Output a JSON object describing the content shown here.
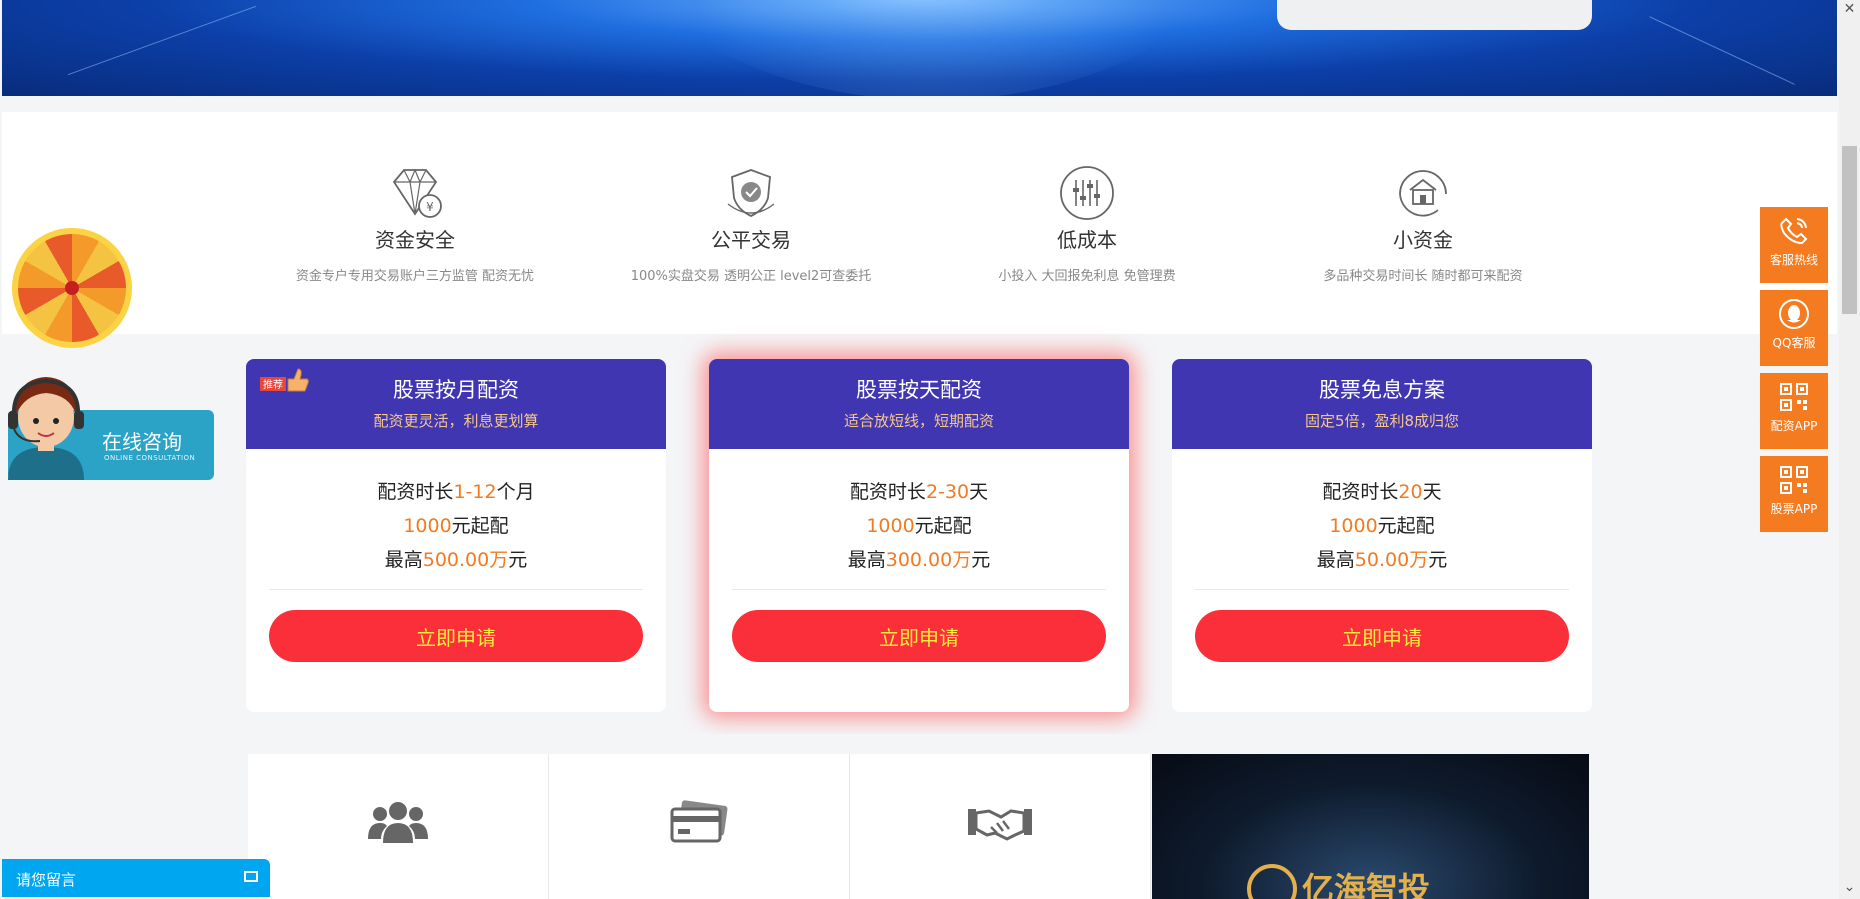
{
  "features": [
    {
      "title": "资金安全",
      "desc": "资金专户专用交易账户三方监管 配资无忧",
      "icon": "diamond-yen-icon"
    },
    {
      "title": "公平交易",
      "desc": "100%实盘交易 透明公正 level2可查委托",
      "icon": "shield-check-icon"
    },
    {
      "title": "低成本",
      "desc": "小投入 大回报免利息 免管理费",
      "icon": "sliders-icon"
    },
    {
      "title": "小资金",
      "desc": "多品种交易时间长 随时都可来配资",
      "icon": "house-icon"
    }
  ],
  "cards": [
    {
      "title": "股票按月配资",
      "subtitle": "配资更灵活，利息更划算",
      "badge": "推荐",
      "duration_pre": "配资时长",
      "duration_val": "1-12",
      "duration_unit": "个月",
      "min_val": "1000",
      "min_unit": "元起配",
      "max_pre": "最高",
      "max_val": "500.00",
      "max_wan": "万",
      "max_unit": "元",
      "button": "立即申请"
    },
    {
      "title": "股票按天配资",
      "subtitle": "适合放短线，短期配资",
      "duration_pre": "配资时长",
      "duration_val": "2-30",
      "duration_unit": "天",
      "min_val": "1000",
      "min_unit": "元起配",
      "max_pre": "最高",
      "max_val": "300.00",
      "max_wan": "万",
      "max_unit": "元",
      "button": "立即申请"
    },
    {
      "title": "股票免息方案",
      "subtitle": "固定5倍，盈利8成归您",
      "duration_pre": "配资时长",
      "duration_val": "20",
      "duration_unit": "天",
      "min_val": "1000",
      "min_unit": "元起配",
      "max_pre": "最高",
      "max_val": "50.00",
      "max_wan": "万",
      "max_unit": "元",
      "button": "立即申请"
    }
  ],
  "consult": {
    "main": "在线咨询",
    "sub": "ONLINE CONSULTATION"
  },
  "message": {
    "label": "请您留言"
  },
  "video": {
    "brand": "亿海智投"
  },
  "side": [
    {
      "label": "客服热线",
      "icon": "phone-icon"
    },
    {
      "label": "QQ客服",
      "icon": "qq-icon"
    },
    {
      "label": "配资APP",
      "icon": "qr-code-icon"
    },
    {
      "label": "股票APP",
      "icon": "qr-code-icon"
    }
  ],
  "colors": {
    "brand_purple": "#4136b2",
    "accent_orange": "#f07b22",
    "button_red": "#fb2f3a",
    "side_orange": "#f47b20"
  }
}
